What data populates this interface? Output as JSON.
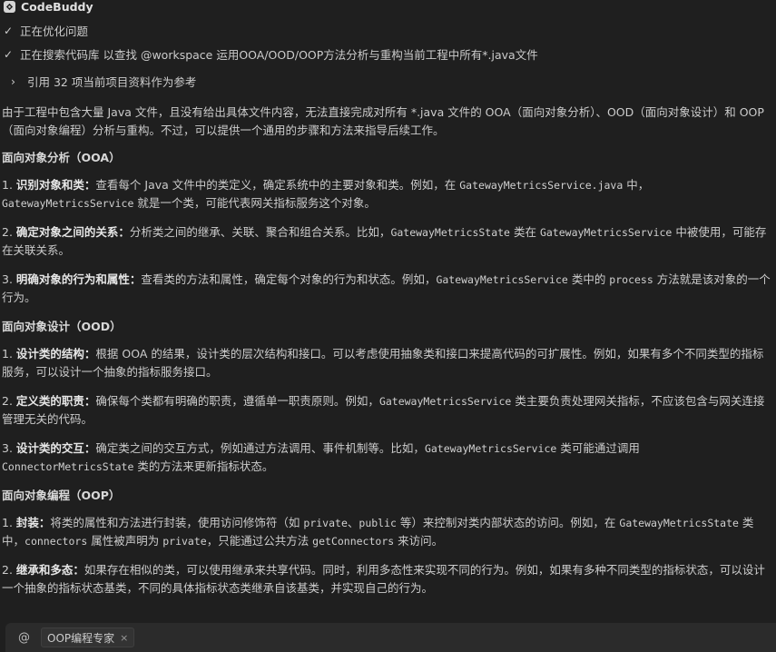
{
  "header": {
    "title": "CodeBuddy",
    "logo_icon": "codebuddy-logo-icon"
  },
  "steps": [
    {
      "label": "正在优化问题"
    },
    {
      "label": "正在搜索代码库 以查找 @workspace 运用OOA/OOD/OOP方法分析与重构当前工程中所有*.java文件"
    }
  ],
  "reference": {
    "label": "引用 32 项当前项目资料作为参考"
  },
  "intro": "由于工程中包含大量 Java 文件，且没有给出具体文件内容，无法直接完成对所有 *.java 文件的 OOA（面向对象分析）、OOD（面向对象设计）和 OOP（面向对象编程）分析与重构。不过，可以提供一个通用的步骤和方法来指导后续工作。",
  "sections": {
    "ooa": {
      "heading": "面向对象分析（OOA）",
      "items": [
        {
          "n": "1. ",
          "title": "识别对象和类：",
          "t1": "查看每个 Java 文件中的类定义，确定系统中的主要对象和类。例如，在 ",
          "c1": "GatewayMetricsService.java",
          "t2": " 中，",
          "c2": "GatewayMetricsService",
          "t3": " 就是一个类，可能代表网关指标服务这个对象。"
        },
        {
          "n": "2. ",
          "title": "确定对象之间的关系：",
          "t1": "分析类之间的继承、关联、聚合和组合关系。比如，",
          "c1": "GatewayMetricsState",
          "t2": " 类在 ",
          "c2": "GatewayMetricsService",
          "t3": " 中被使用，可能存在关联关系。"
        },
        {
          "n": "3. ",
          "title": "明确对象的行为和属性：",
          "t1": "查看类的方法和属性，确定每个对象的行为和状态。例如，",
          "c1": "GatewayMetricsService",
          "t2": " 类中的 ",
          "c2": "process",
          "t3": " 方法就是该对象的一个行为。"
        }
      ]
    },
    "ood": {
      "heading": "面向对象设计（OOD）",
      "items": [
        {
          "n": "1. ",
          "title": "设计类的结构：",
          "t1": "根据 OOA 的结果，设计类的层次结构和接口。可以考虑使用抽象类和接口来提高代码的可扩展性。例如，如果有多个不同类型的指标服务，可以设计一个抽象的指标服务接口。"
        },
        {
          "n": "2. ",
          "title": "定义类的职责：",
          "t1": "确保每个类都有明确的职责，遵循单一职责原则。例如，",
          "c1": "GatewayMetricsService",
          "t2": " 类主要负责处理网关指标，不应该包含与网关连接管理无关的代码。"
        },
        {
          "n": "3. ",
          "title": "设计类的交互：",
          "t1": "确定类之间的交互方式，例如通过方法调用、事件机制等。比如，",
          "c1": "GatewayMetricsService",
          "t2": " 类可能通过调用 ",
          "c2": "ConnectorMetricsState",
          "t3": " 类的方法来更新指标状态。"
        }
      ]
    },
    "oop": {
      "heading": "面向对象编程（OOP）",
      "items": [
        {
          "n": "1. ",
          "title": "封装：",
          "t1": "将类的属性和方法进行封装，使用访问修饰符（如 ",
          "c1": "private",
          "t2": "、",
          "c2": "public",
          "t3": " 等）来控制对类内部状态的访问。例如，在 ",
          "c3": "GatewayMetricsState",
          "t4": " 类中，",
          "c4": "connectors",
          "t5": " 属性被声明为 ",
          "c5": "private",
          "t6": "，只能通过公共方法 ",
          "c6": "getConnectors",
          "t7": " 来访问。"
        },
        {
          "n": "2. ",
          "title": "继承和多态：",
          "t1": "如果存在相似的类，可以使用继承来共享代码。同时，利用多态性来实现不同的行为。例如，如果有多种不同类型的指标状态，可以设计一个抽象的指标状态基类，不同的具体指标状态类继承自该基类，并实现自己的行为。"
        }
      ]
    }
  },
  "input_bar": {
    "at_symbol": "@",
    "chip_label": "OOP编程专家",
    "chip_close": "×"
  }
}
